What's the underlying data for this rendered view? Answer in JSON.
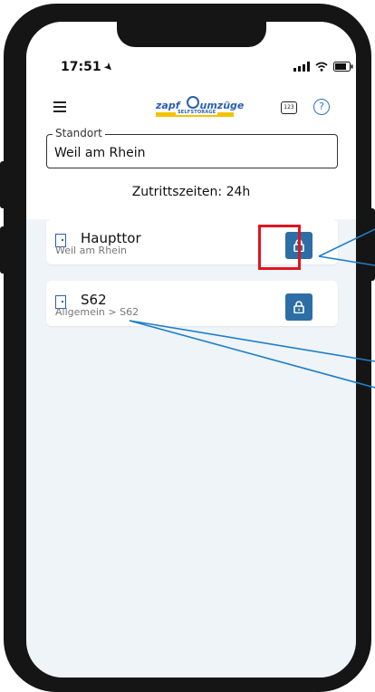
{
  "status_bar": {
    "time": "17:51"
  },
  "header": {
    "menu_icon": "hamburger-menu-icon",
    "brand": {
      "left": "zapf",
      "right": "umzüge",
      "sub": "SELFSTORAGE"
    },
    "keypad_label": "123",
    "help_glyph": "?"
  },
  "location": {
    "label": "Standort",
    "value": "Weil am Rhein"
  },
  "access_times": "Zutrittszeiten: 24h",
  "doors": [
    {
      "name": "Haupttor",
      "subtitle": "Weil am Rhein",
      "action_icon": "unlock-icon"
    },
    {
      "name": "S62",
      "subtitle": "Allgemein > S62",
      "action_icon": "unlock-icon"
    }
  ],
  "colors": {
    "primary": "#2d6ea6",
    "background": "#eef4f8",
    "highlight": "#e0141e",
    "annotation": "#1e7ec8",
    "brand_yellow": "#f2c400"
  }
}
